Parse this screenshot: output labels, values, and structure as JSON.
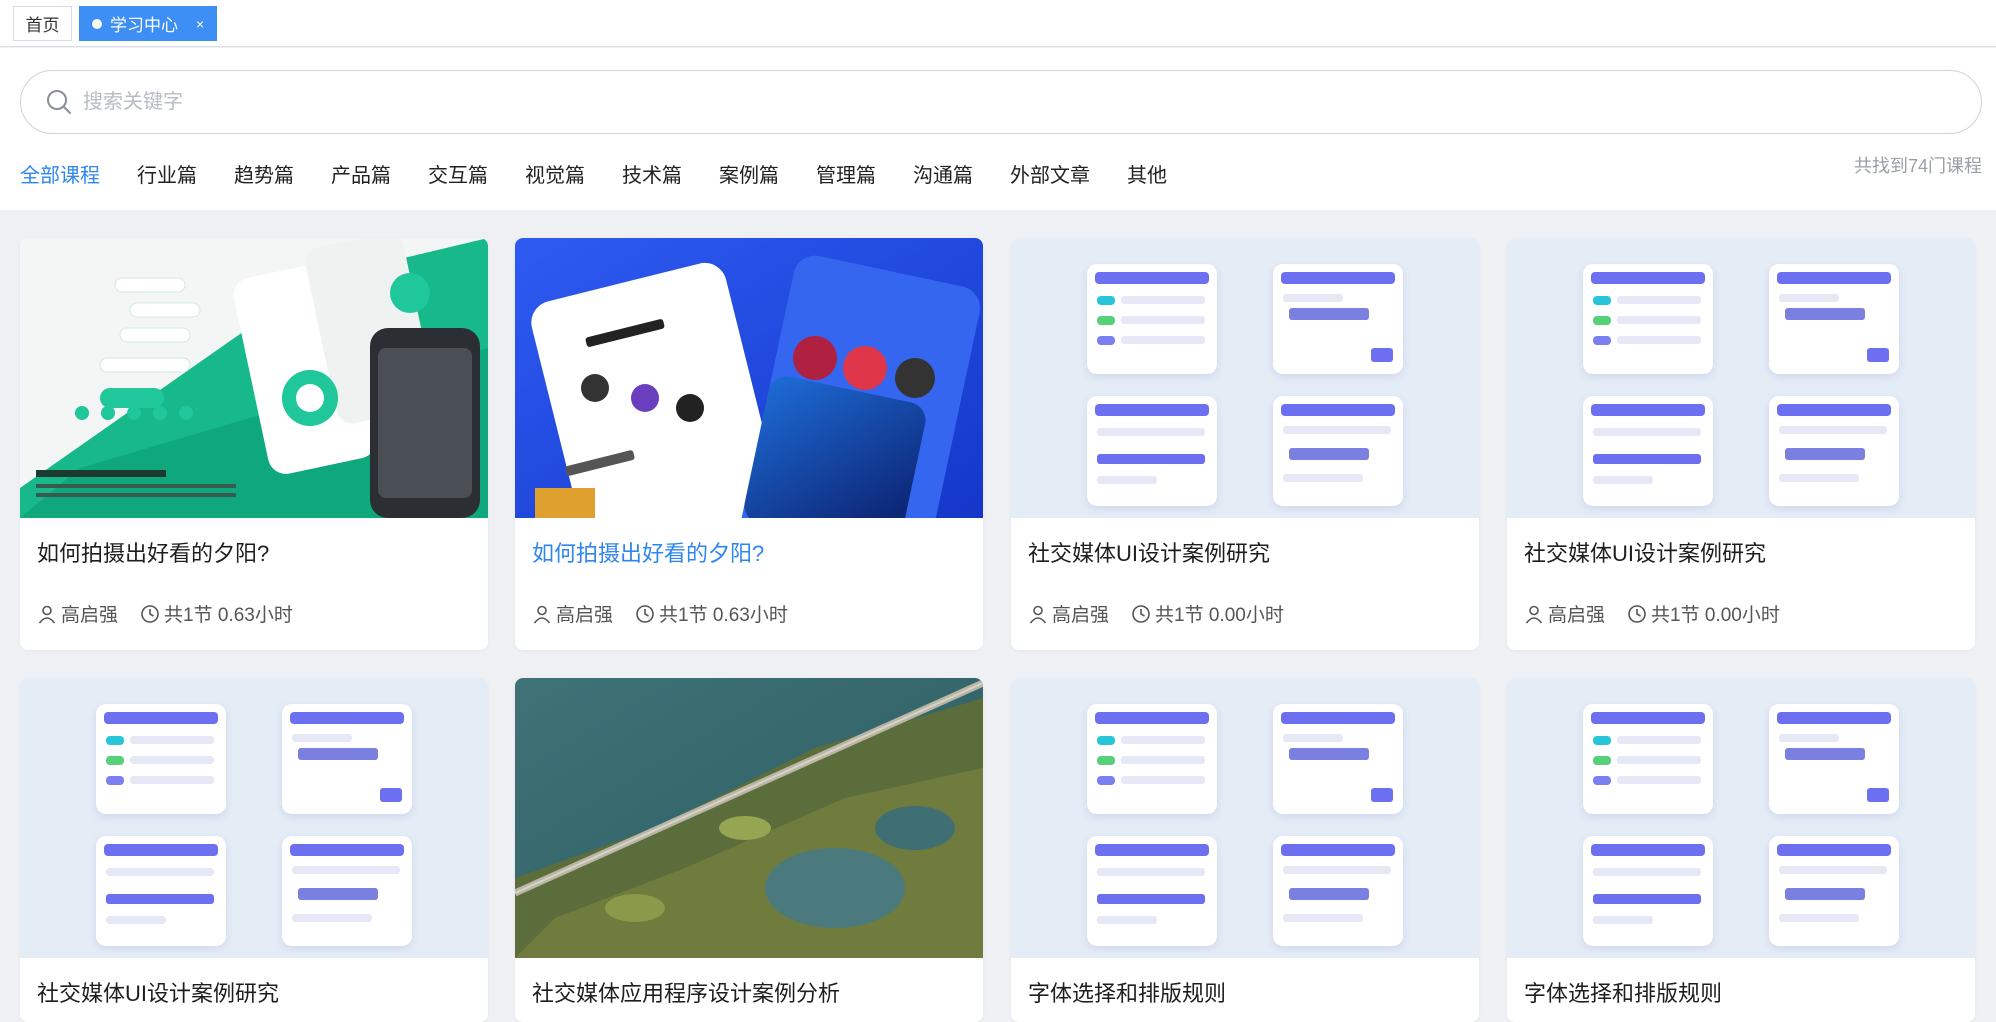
{
  "tabs": {
    "home": "首页",
    "learning_center": "学习中心",
    "close": "×"
  },
  "search": {
    "placeholder": "搜索关键字"
  },
  "categories": [
    {
      "label": "全部课程",
      "active": true
    },
    {
      "label": "行业篇"
    },
    {
      "label": "趋势篇"
    },
    {
      "label": "产品篇"
    },
    {
      "label": "交互篇"
    },
    {
      "label": "视觉篇"
    },
    {
      "label": "技术篇"
    },
    {
      "label": "案例篇"
    },
    {
      "label": "管理篇"
    },
    {
      "label": "沟通篇"
    },
    {
      "label": "外部文章"
    },
    {
      "label": "其他"
    }
  ],
  "total_text": "共找到74门课程",
  "colors": {
    "accent": "#2f86f0",
    "tab_active": "#3d8ef5"
  },
  "courses": [
    {
      "title": "如何拍摄出好看的夕阳?",
      "author": "高启强",
      "info": "共1节 0.63小时",
      "thumb": "green-app-mockup"
    },
    {
      "title": "如何拍摄出好看的夕阳?",
      "author": "高启强",
      "info": "共1节 0.63小时",
      "thumb": "blue-shop-app-mockup",
      "highlighted": true
    },
    {
      "title": "社交媒体UI设计案例研究",
      "author": "高启强",
      "info": "共1节 0.00小时",
      "thumb": "phone-dashboard-mockup"
    },
    {
      "title": "社交媒体UI设计案例研究",
      "author": "高启强",
      "info": "共1节 0.00小时",
      "thumb": "phone-dashboard-mockup"
    },
    {
      "title": "社交媒体UI设计案例研究",
      "thumb": "phone-dashboard-mockup"
    },
    {
      "title": "社交媒体应用程序设计案例分析",
      "thumb": "aerial-road-photo"
    },
    {
      "title": "字体选择和排版规则",
      "thumb": "phone-dashboard-mockup"
    },
    {
      "title": "字体选择和排版规则",
      "thumb": "phone-dashboard-mockup"
    }
  ],
  "icons": {
    "search": "search-icon",
    "author": "user-icon",
    "duration": "clock-icon"
  }
}
